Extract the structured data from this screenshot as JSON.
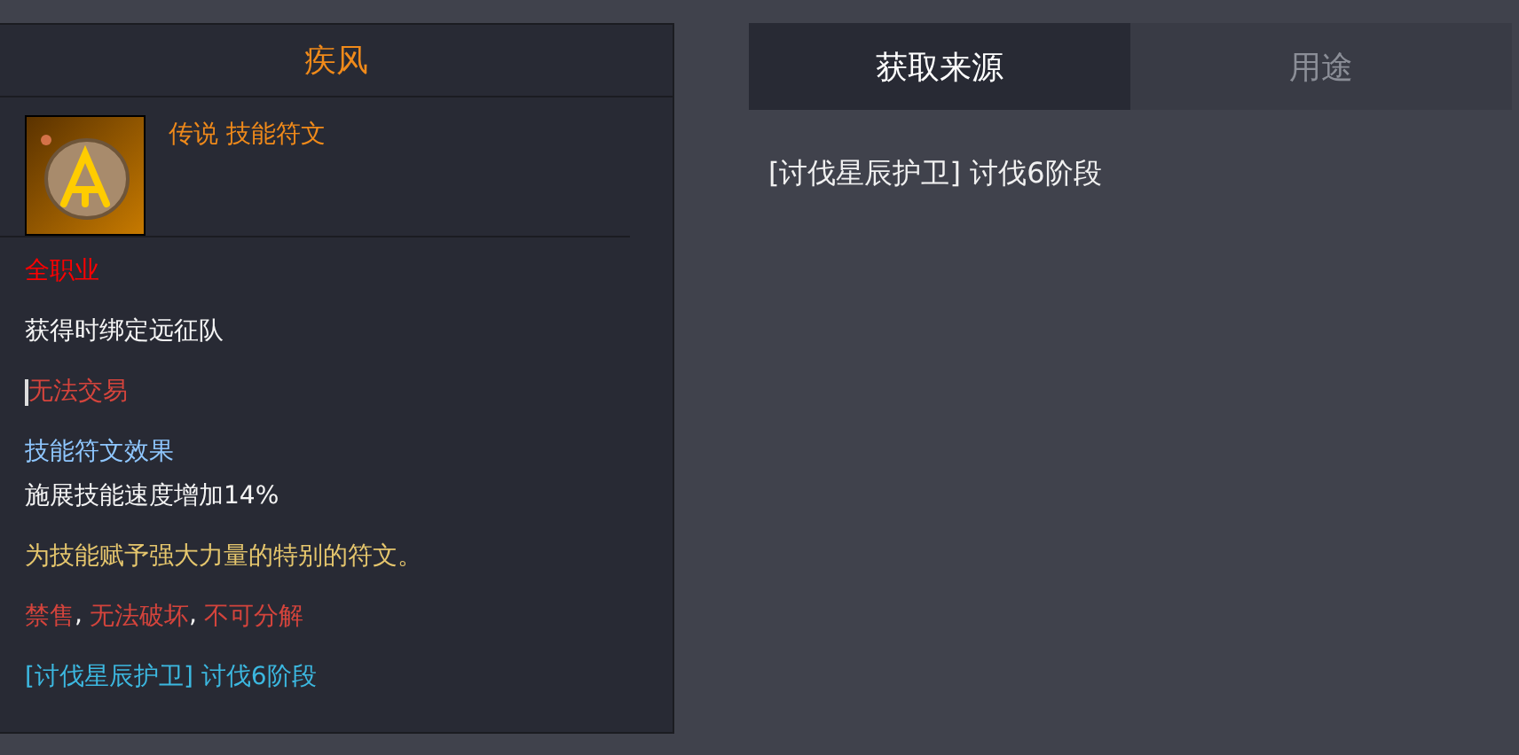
{
  "item": {
    "name": "疾风",
    "grade": "传说 技能符文",
    "lines": [
      {
        "kind": "class",
        "text": "全职业"
      },
      {
        "kind": "bind",
        "text": "获得时绑定远征队"
      },
      {
        "kind": "trade",
        "text": "无法交易",
        "cursor": true
      },
      {
        "kind": "section",
        "text": "技能符文效果"
      },
      {
        "kind": "stat",
        "text": "施展技能速度增加14%"
      },
      {
        "kind": "description",
        "text": "为技能赋予强大力量的特别的符文。"
      },
      {
        "kind": "restrictions",
        "items": [
          "禁售",
          "无法破坏",
          "不可分解"
        ],
        "separator": ","
      },
      {
        "kind": "source",
        "text": "[讨伐星辰护卫] 讨伐6阶段"
      }
    ]
  },
  "tabs": [
    {
      "label": "获取来源",
      "selected": true
    },
    {
      "label": "用途",
      "selected": false
    }
  ],
  "sources": [
    "[讨伐星辰护卫] 讨伐6阶段"
  ]
}
